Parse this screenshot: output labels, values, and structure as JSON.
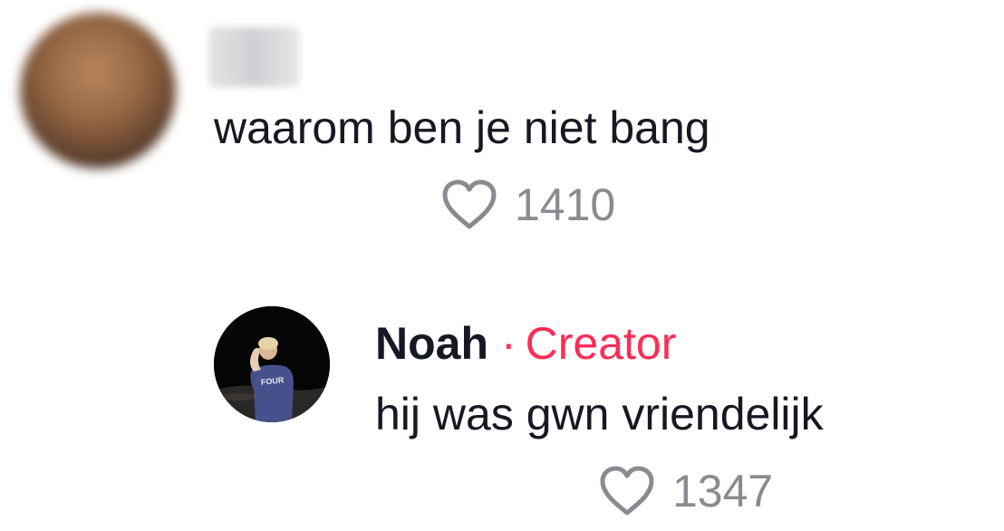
{
  "comments": [
    {
      "text": "waarom ben je niet bang",
      "likes": "1410"
    }
  ],
  "reply": {
    "author": "Noah",
    "separator": "·",
    "badge": "Creator",
    "text": "hij was gwn vriendelijk",
    "likes": "1347",
    "shirt_text": "FOUR"
  },
  "colors": {
    "text": "#161823",
    "muted": "#8a8b91",
    "accent": "#fe2c55"
  },
  "icons": {
    "like": "heart-outline-icon"
  }
}
